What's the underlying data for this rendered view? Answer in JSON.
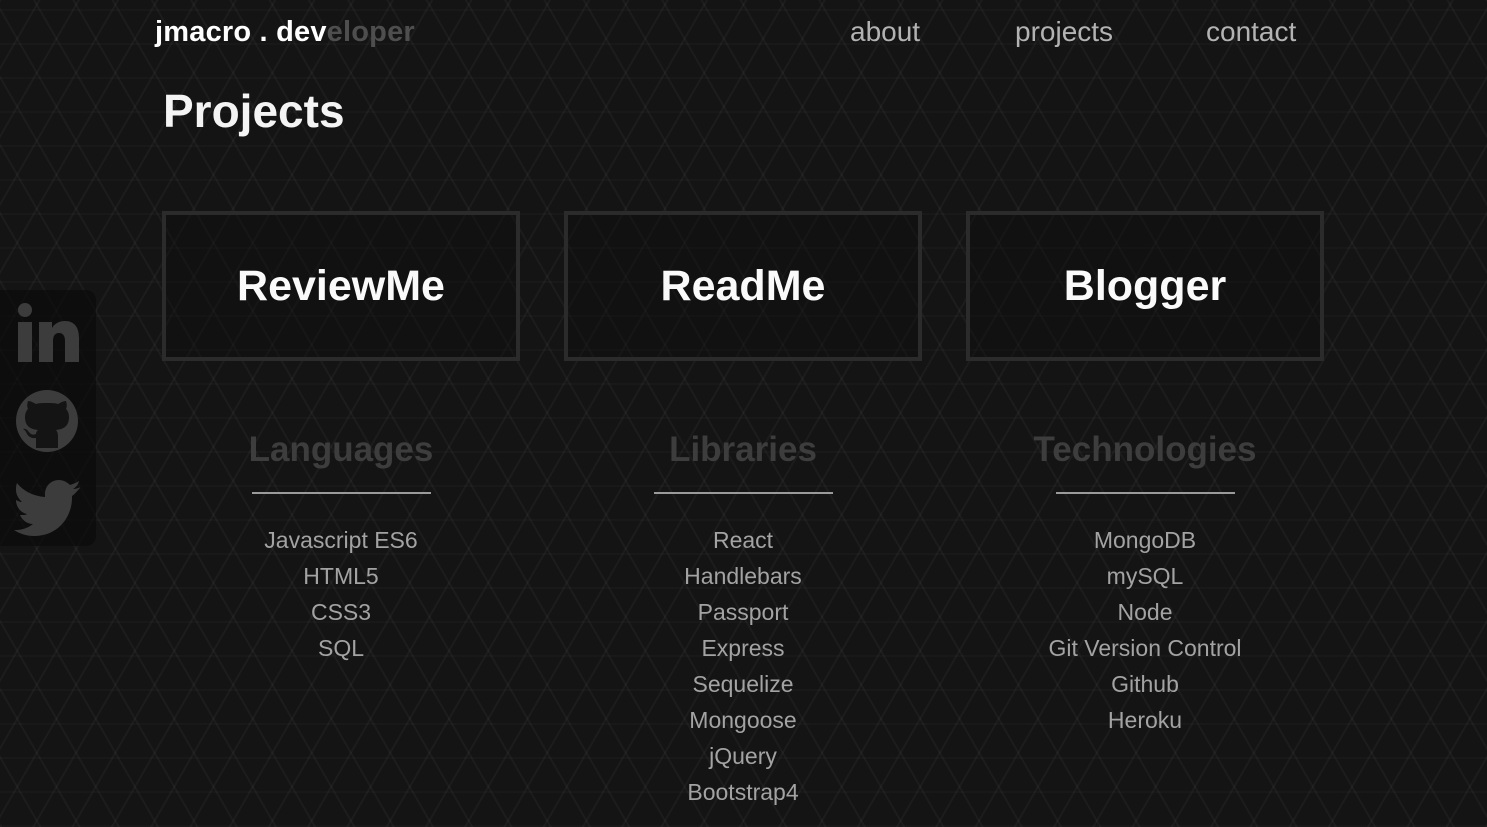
{
  "header": {
    "brand_bright": "jmacro . dev",
    "brand_dim": "eloper",
    "nav": {
      "about": "about",
      "projects": "projects",
      "contact": "contact"
    }
  },
  "page": {
    "title": "Projects"
  },
  "social": {
    "icons": [
      "linkedin-icon",
      "github-icon",
      "twitter-icon"
    ]
  },
  "projects": [
    {
      "title": "ReviewMe"
    },
    {
      "title": "ReadMe"
    },
    {
      "title": "Blogger"
    }
  ],
  "skills": [
    {
      "heading": "Languages",
      "items": [
        "Javascript ES6",
        "HTML5",
        "CSS3",
        "SQL"
      ]
    },
    {
      "heading": "Libraries",
      "items": [
        "React",
        "Handlebars",
        "Passport",
        "Express",
        "Sequelize",
        "Mongoose",
        "jQuery",
        "Bootstrap4"
      ]
    },
    {
      "heading": "Technologies",
      "items": [
        "MongoDB",
        "mySQL",
        "Node",
        "Git Version Control",
        "Github",
        "Heroku"
      ]
    }
  ],
  "colors": {
    "background": "#141414",
    "brand_dim": "#4e4e4e",
    "nav_text": "#b3b3b3",
    "card_border": "#2b2b2b",
    "skill_heading": "#3d3d3d",
    "skill_item": "#a3a3a3",
    "icon": "#3c3c3c"
  }
}
